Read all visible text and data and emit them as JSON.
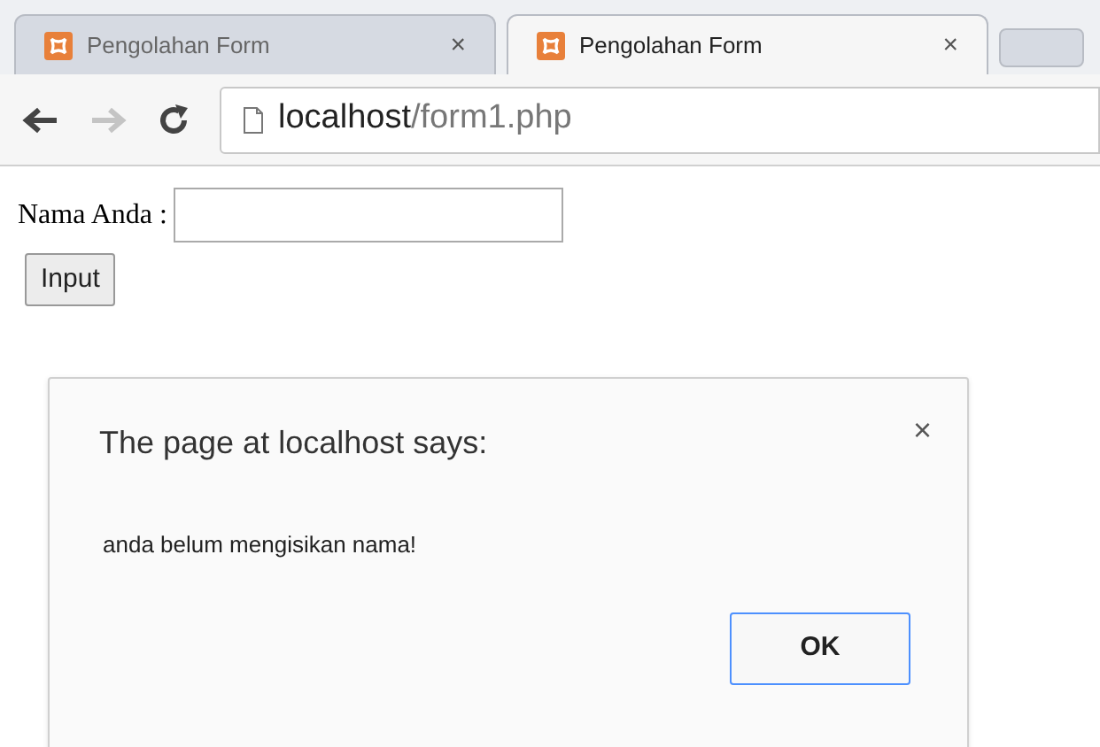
{
  "tabs": [
    {
      "title": "Pengolahan Form",
      "close": "×",
      "selected": false
    },
    {
      "title": "Pengolahan Form",
      "close": "×",
      "selected": true
    }
  ],
  "address_bar": {
    "host": "localhost",
    "path": "/form1.php"
  },
  "form": {
    "label": "Nama Anda :",
    "button": "Input"
  },
  "dialog": {
    "title": "The page at localhost says:",
    "close": "×",
    "message": "anda belum mengisikan nama!",
    "ok": "OK"
  }
}
